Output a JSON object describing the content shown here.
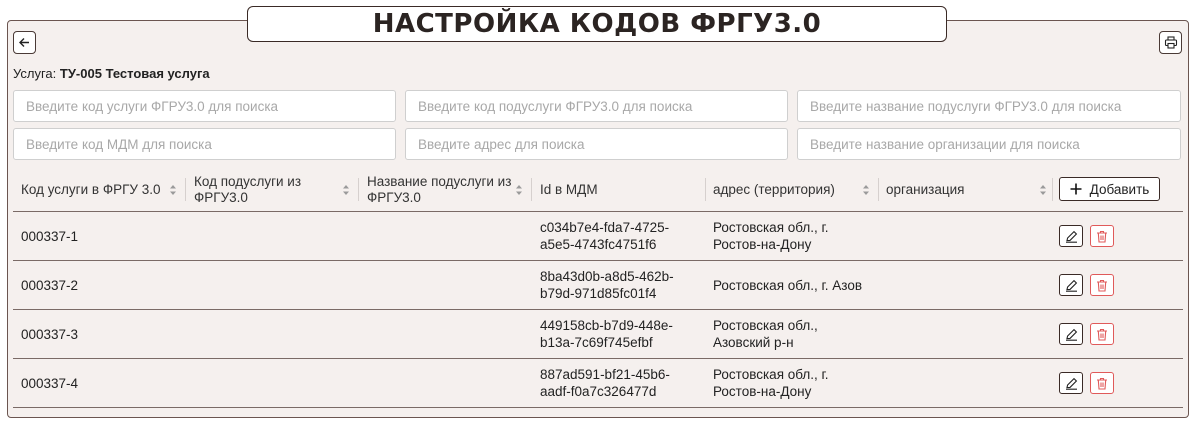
{
  "header": {
    "title": "НАСТРОЙКА КОДОВ ФРГУ3.0",
    "back_icon": "arrow-left-icon",
    "print_icon": "printer-icon"
  },
  "service": {
    "label": "Услуга:",
    "value": "ТУ-005 Тестовая услуга"
  },
  "filters": {
    "service_code": "Введите код услуги ФГРУ3.0 для поиска",
    "subservice_code": "Введите код подуслуги ФГРУ3.0 для поиска",
    "subservice_name": "Введите название подуслуги ФГРУ3.0 для поиска",
    "mdm_code": "Введите код МДМ для поиска",
    "address": "Введите адрес для поиска",
    "organization": "Введите название организации для поиска"
  },
  "table": {
    "columns": {
      "service_code": "Код услуги в ФРГУ 3.0",
      "subservice_code": "Код подуслуги из ФРГУ3.0",
      "subservice_name": "Название подуслуги из ФРГУ3.0",
      "mdm_id": "Id в МДМ",
      "address": "адрес (территория)",
      "organization": "организация"
    },
    "add_label": "Добавить",
    "rows": [
      {
        "service_code": "000337-1",
        "subservice_code": "",
        "subservice_name": "",
        "mdm_id_1": "c034b7e4-fda7-4725-",
        "mdm_id_2": "a5e5-4743fc4751f6",
        "address_1": "Ростовская обл., г.",
        "address_2": "Ростов-на-Дону",
        "organization": ""
      },
      {
        "service_code": "000337-2",
        "subservice_code": "",
        "subservice_name": "",
        "mdm_id_1": "8ba43d0b-a8d5-462b-",
        "mdm_id_2": "b79d-971d85fc01f4",
        "address_1": "Ростовская обл., г. Азов",
        "address_2": "",
        "organization": ""
      },
      {
        "service_code": "000337-3",
        "subservice_code": "",
        "subservice_name": "",
        "mdm_id_1": "449158cb-b7d9-448e-",
        "mdm_id_2": "b13a-7c69f745efbf",
        "address_1": "Ростовская обл.,",
        "address_2": "Азовский р-н",
        "organization": ""
      },
      {
        "service_code": "000337-4",
        "subservice_code": "",
        "subservice_name": "",
        "mdm_id_1": "887ad591-bf21-45b6-",
        "mdm_id_2": "aadf-f0a7c326477d",
        "address_1": "Ростовская обл., г.",
        "address_2": "Ростов-на-Дону",
        "organization": ""
      }
    ]
  },
  "colors": {
    "accent": "#6b5550",
    "background": "#f5f0ee",
    "delete": "#e05a5a"
  }
}
